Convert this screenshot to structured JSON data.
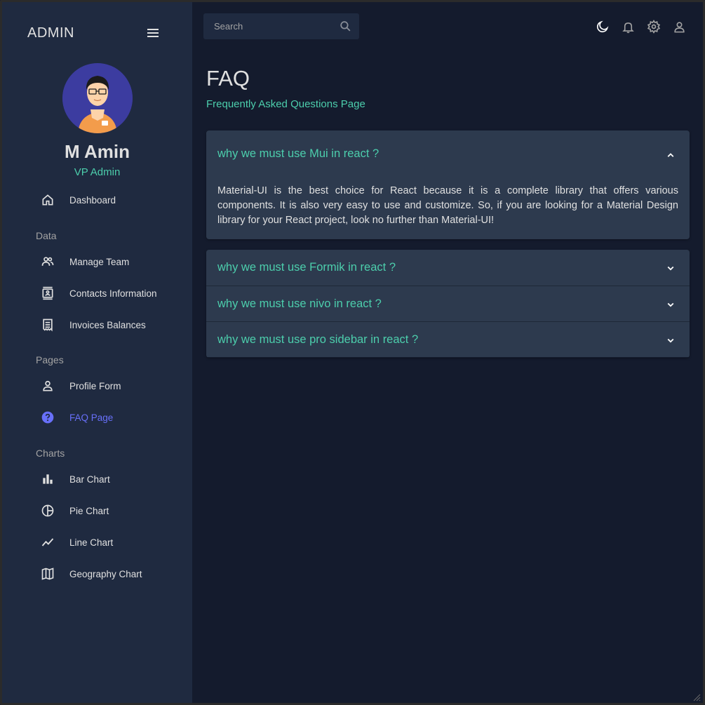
{
  "sidebar": {
    "brand": "ADMIN",
    "user": {
      "name": "M Amin",
      "role": "VP Admin"
    },
    "items": [
      {
        "label": "Dashboard",
        "icon": "home-icon"
      },
      {
        "label": "Manage Team",
        "icon": "people-icon"
      },
      {
        "label": "Contacts Information",
        "icon": "contacts-icon"
      },
      {
        "label": "Invoices Balances",
        "icon": "receipt-icon"
      },
      {
        "label": "Profile Form",
        "icon": "person-icon"
      },
      {
        "label": "FAQ Page",
        "icon": "help-icon",
        "active": true
      },
      {
        "label": "Bar Chart",
        "icon": "bar-chart-icon"
      },
      {
        "label": "Pie Chart",
        "icon": "pie-chart-icon"
      },
      {
        "label": "Line Chart",
        "icon": "line-chart-icon"
      },
      {
        "label": "Geography Chart",
        "icon": "map-icon"
      }
    ],
    "sections": [
      "Data",
      "Pages",
      "Charts"
    ]
  },
  "topbar": {
    "search_placeholder": "Search",
    "icons": [
      "moon-icon",
      "bell-icon",
      "gear-icon",
      "user-icon"
    ]
  },
  "main": {
    "title": "FAQ",
    "subtitle": "Frequently Asked Questions Page",
    "faqs": [
      {
        "question": "why we must use Mui in react ?",
        "answer": "Material-UI is the best choice for React because it is a complete library that offers various components. It is also very easy to use and customize. So, if you are looking for a Material Design library for your React project, look no further than Material-UI!",
        "expanded": true
      },
      {
        "question": "why we must use Formik in react ?",
        "expanded": false
      },
      {
        "question": "why we must use nivo in react ?",
        "expanded": false
      },
      {
        "question": "why we must use pro sidebar in react ?",
        "expanded": false
      }
    ]
  },
  "colors": {
    "background": "#141b2d",
    "panel": "#1f2a40",
    "accordion": "#2d3a4e",
    "accent": "#4cceac",
    "active": "#6870fa"
  }
}
